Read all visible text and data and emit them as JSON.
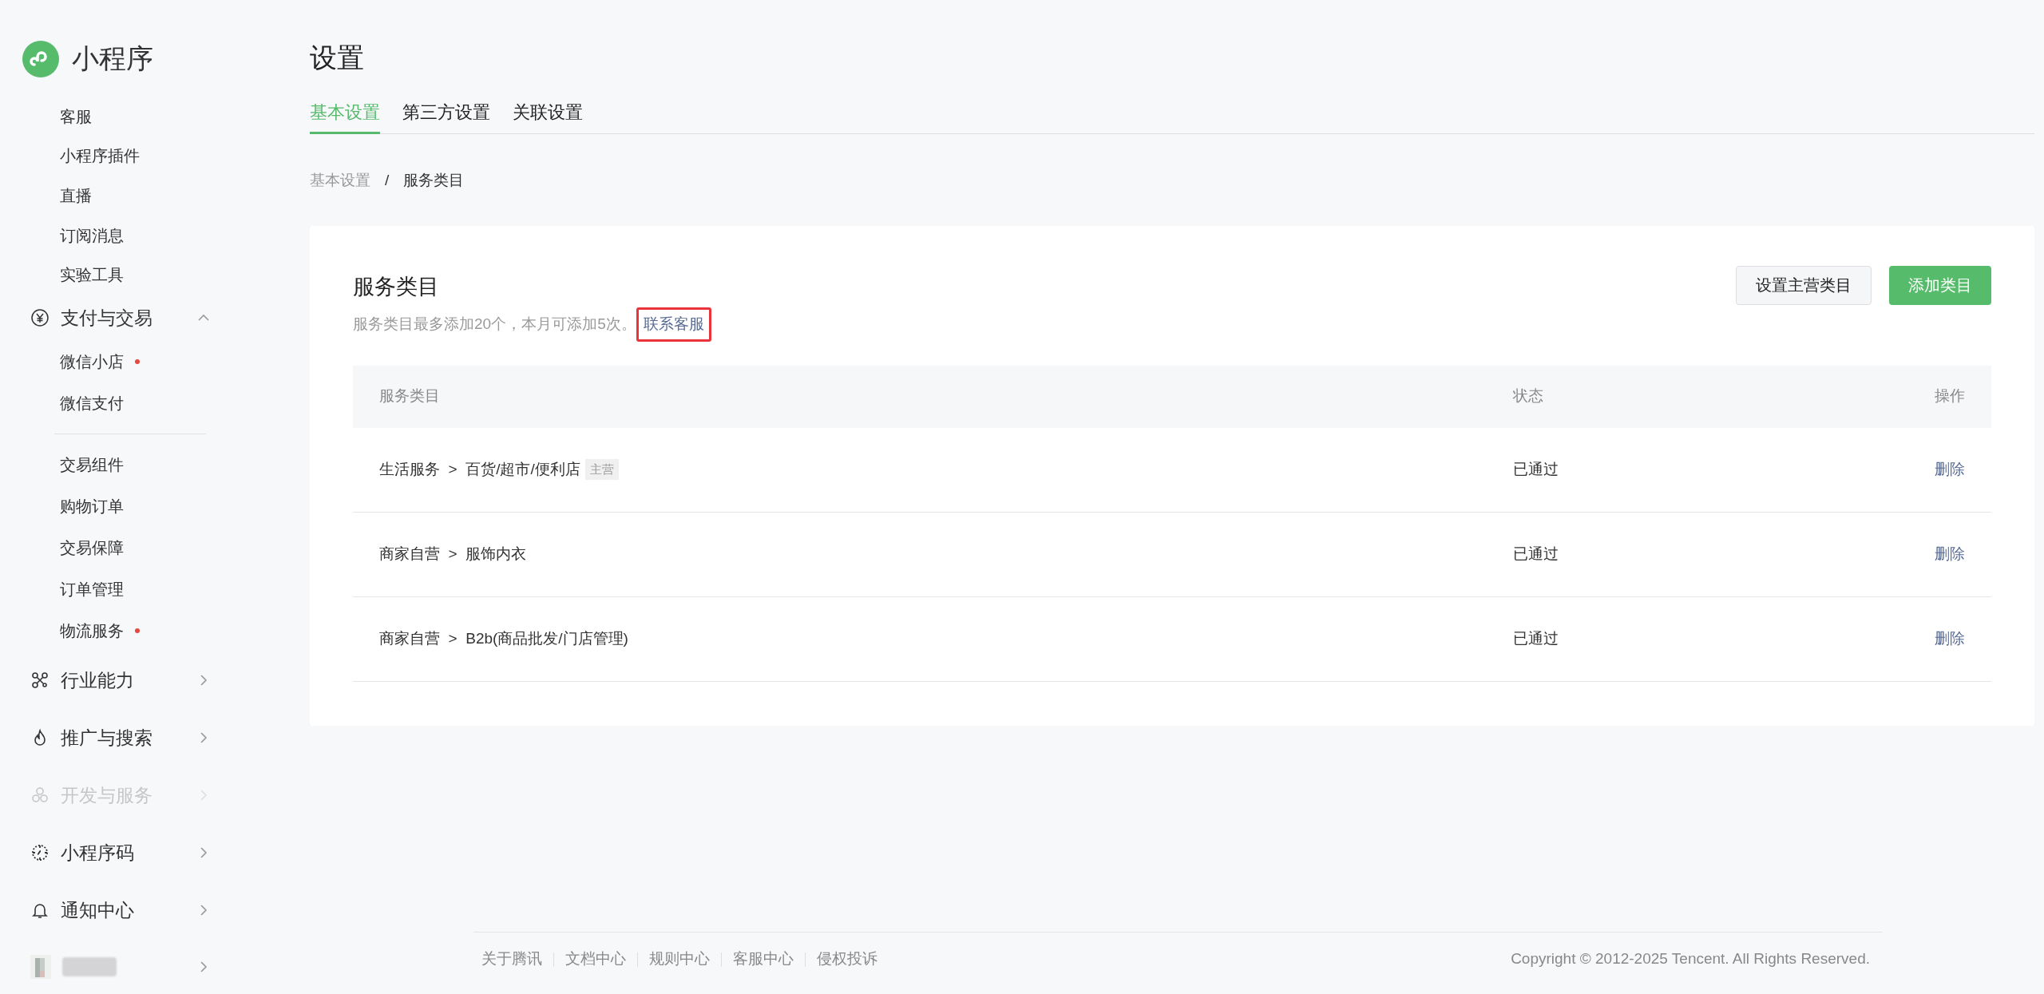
{
  "brand": {
    "name": "小程序"
  },
  "sidebar": {
    "items": [
      {
        "kind": "link",
        "label": "客服"
      },
      {
        "kind": "link",
        "label": "小程序插件"
      },
      {
        "kind": "link",
        "label": "直播"
      },
      {
        "kind": "link",
        "label": "订阅消息"
      },
      {
        "kind": "link",
        "label": "实验工具"
      },
      {
        "kind": "group",
        "label": "支付与交易",
        "expanded": true,
        "faded": false,
        "children": [
          {
            "label": "微信小店",
            "dot": true,
            "divider_before": false
          },
          {
            "label": "微信支付",
            "dot": false,
            "divider_before": false
          },
          {
            "label": "交易组件",
            "dot": false,
            "divider_before": true
          },
          {
            "label": "购物订单",
            "dot": false,
            "divider_before": false
          },
          {
            "label": "交易保障",
            "dot": false,
            "divider_before": false
          },
          {
            "label": "订单管理",
            "dot": false,
            "divider_before": false
          },
          {
            "label": "物流服务",
            "dot": true,
            "divider_before": false
          }
        ]
      },
      {
        "kind": "group",
        "label": "行业能力",
        "expanded": false,
        "faded": false
      },
      {
        "kind": "group",
        "label": "推广与搜索",
        "expanded": false,
        "faded": false
      },
      {
        "kind": "group",
        "label": "开发与服务",
        "expanded": false,
        "faded": true
      },
      {
        "kind": "group",
        "label": "小程序码",
        "expanded": false,
        "faded": false
      },
      {
        "kind": "group",
        "label": "通知中心",
        "expanded": false,
        "faded": false
      },
      {
        "kind": "profile",
        "expanded": false
      }
    ]
  },
  "page": {
    "title": "设置"
  },
  "tabs": [
    {
      "label": "基本设置",
      "selected": true
    },
    {
      "label": "第三方设置",
      "selected": false
    },
    {
      "label": "关联设置",
      "selected": false
    }
  ],
  "breadcrumb": [
    {
      "label": "基本设置",
      "current": false
    },
    {
      "label": "服务类目",
      "current": true
    }
  ],
  "breadcrumb_separator": "/",
  "card": {
    "title": "服务类目",
    "note": "服务类目最多添加20个，本月可添加5次。",
    "note_link": {
      "label": "联系客服",
      "highlighted": true
    },
    "buttons": [
      {
        "label": "设置主营类目",
        "kind": "secondary"
      },
      {
        "label": "添加类目",
        "kind": "primary"
      }
    ]
  },
  "table": {
    "columns": [
      "服务类目",
      "状态",
      "操作"
    ],
    "rows": [
      {
        "category": "生活服务  >  百货/超市/便利店",
        "tag": "主营",
        "status": "已通过",
        "action": "删除"
      },
      {
        "category": "商家自营  >  服饰内衣",
        "status": "已通过",
        "action": "删除"
      },
      {
        "category": "商家自营  >  B2b(商品批发/门店管理)",
        "status": "已通过",
        "action": "删除"
      }
    ]
  },
  "footer": {
    "links": [
      "关于腾讯",
      "文档中心",
      "规则中心",
      "客服中心",
      "侵权投诉"
    ],
    "copyright": "Copyright © 2012-2025 Tencent. All Rights Reserved."
  }
}
